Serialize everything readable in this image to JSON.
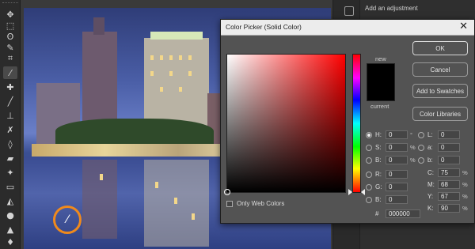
{
  "dialog": {
    "title": "Color Picker (Solid Color)",
    "close_icon": "close-icon",
    "new_label": "new",
    "current_label": "current",
    "new_color": "#000000",
    "buttons": {
      "ok": "OK",
      "cancel": "Cancel",
      "add_to_swatches": "Add to Swatches",
      "color_libraries": "Color Libraries"
    },
    "only_web_colors": "Only Web Colors",
    "hsb": [
      {
        "label": "H:",
        "value": "0",
        "unit": "°",
        "selected": true
      },
      {
        "label": "S:",
        "value": "0",
        "unit": "%",
        "selected": false
      },
      {
        "label": "B:",
        "value": "0",
        "unit": "%",
        "selected": false
      }
    ],
    "rgb": [
      {
        "label": "R:",
        "value": "0"
      },
      {
        "label": "G:",
        "value": "0"
      },
      {
        "label": "B:",
        "value": "0"
      }
    ],
    "lab": [
      {
        "label": "L:",
        "value": "0"
      },
      {
        "label": "a:",
        "value": "0"
      },
      {
        "label": "b:",
        "value": "0"
      }
    ],
    "cmyk": [
      {
        "label": "C:",
        "value": "75",
        "unit": "%"
      },
      {
        "label": "M:",
        "value": "68",
        "unit": "%"
      },
      {
        "label": "Y:",
        "value": "67",
        "unit": "%"
      },
      {
        "label": "K:",
        "value": "90",
        "unit": "%"
      }
    ],
    "hex": {
      "label": "#",
      "value": "000000"
    }
  },
  "right_panel": {
    "adjustment_label": "Add an adjustment"
  },
  "toolbar": {
    "tools": [
      "move-tool-icon",
      "marquee-tool-icon",
      "lasso-tool-icon",
      "quick-select-tool-icon",
      "crop-tool-icon",
      "eyedropper-tool-icon",
      "spot-heal-tool-icon",
      "brush-tool-icon",
      "clone-stamp-tool-icon",
      "history-brush-tool-icon",
      "eraser-tool-icon",
      "gradient-tool-icon",
      "blur-tool-icon",
      "dodge-tool-icon",
      "pen-tool-icon",
      "type-tool-icon",
      "path-select-tool-icon",
      "shape-tool-icon"
    ]
  }
}
